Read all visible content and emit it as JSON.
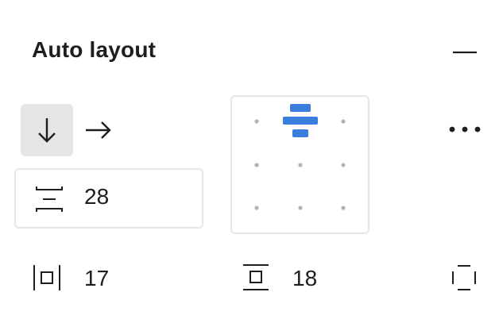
{
  "auto_layout": {
    "title": "Auto layout",
    "collapse_icon": "minus-icon",
    "direction": {
      "vertical_icon": "arrow-down-icon",
      "horizontal_icon": "arrow-right-icon",
      "selected": "vertical"
    },
    "gap": {
      "icon": "vertical-gap-icon",
      "value": "28"
    },
    "alignment": {
      "selected": "top-center",
      "icon": "align-top-center-icon"
    },
    "more_icon": "more-horizontal-icon",
    "padding_horizontal": {
      "icon": "horizontal-padding-icon",
      "value": "17"
    },
    "padding_vertical": {
      "icon": "vertical-padding-icon",
      "value": "18"
    },
    "individual_padding_icon": "individual-padding-icon",
    "colors": {
      "accent": "#3b7ddd",
      "dot": "#b3b3b3",
      "selected_bg": "#e5e5e5",
      "border": "#e6e6e6",
      "text": "#1e1e1e"
    }
  }
}
